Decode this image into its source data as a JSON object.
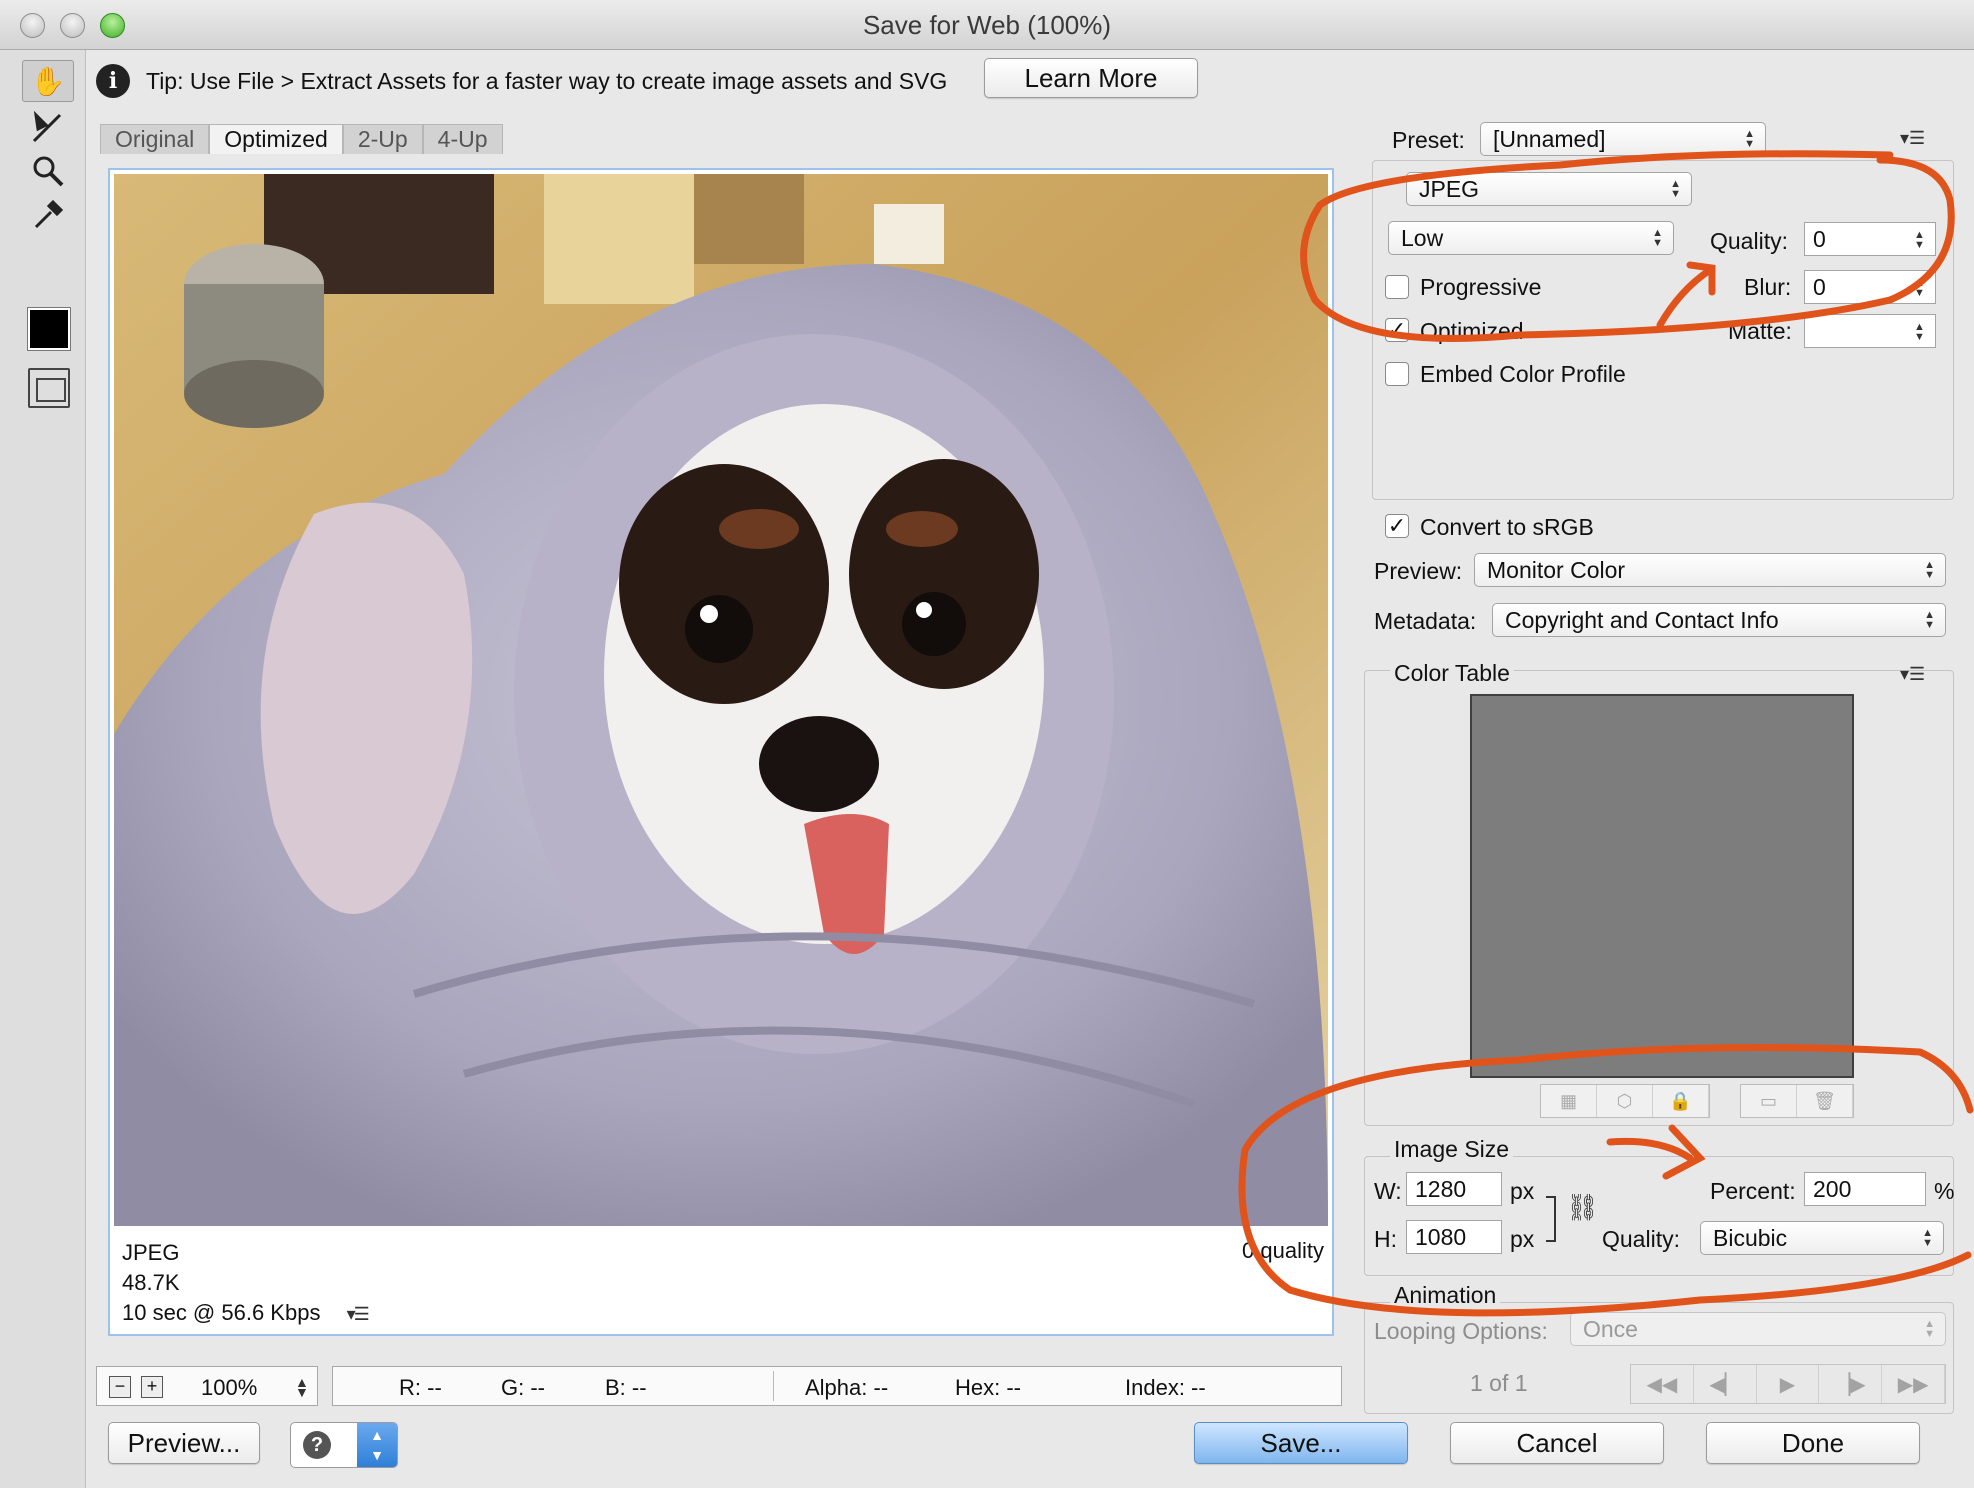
{
  "window": {
    "title": "Save for Web (100%)"
  },
  "tip": {
    "text": "Tip: Use File > Extract Assets for a faster way to create image assets and SVG",
    "learn_more": "Learn More"
  },
  "view_tabs": [
    "Original",
    "Optimized",
    "2-Up",
    "4-Up"
  ],
  "preview": {
    "format": "JPEG",
    "size": "48.7K",
    "download_time": "10 sec @ 56.6 Kbps",
    "quality_note": "0 quality"
  },
  "status": {
    "zoom": "100%",
    "r": "R: --",
    "g": "G: --",
    "b": "B: --",
    "alpha": "Alpha: --",
    "hex": "Hex: --",
    "index": "Index: --"
  },
  "settings": {
    "preset_label": "Preset:",
    "preset_value": "[Unnamed]",
    "format_value": "JPEG",
    "compression_value": "Low",
    "quality_label": "Quality:",
    "quality_value": "0",
    "blur_label": "Blur:",
    "blur_value": "0",
    "matte_label": "Matte:",
    "matte_value": "",
    "progressive_label": "Progressive",
    "progressive_checked": false,
    "optimized_label": "Optimized",
    "optimized_checked": true,
    "embed_label": "Embed Color Profile",
    "embed_checked": false,
    "convert_label": "Convert to sRGB",
    "convert_checked": true,
    "preview_label": "Preview:",
    "preview_value": "Monitor Color",
    "metadata_label": "Metadata:",
    "metadata_value": "Copyright and Contact Info"
  },
  "color_table": {
    "title": "Color Table"
  },
  "image_size": {
    "title": "Image Size",
    "w_label": "W:",
    "w_value": "1280",
    "w_unit": "px",
    "h_label": "H:",
    "h_value": "1080",
    "h_unit": "px",
    "percent_label": "Percent:",
    "percent_value": "200",
    "percent_unit": "%",
    "quality_label": "Quality:",
    "quality_value": "Bicubic"
  },
  "animation": {
    "title": "Animation",
    "looping_label": "Looping Options:",
    "looping_value": "Once",
    "frame_counter": "1 of 1"
  },
  "buttons": {
    "preview": "Preview...",
    "save": "Save...",
    "cancel": "Cancel",
    "done": "Done"
  },
  "colors": {
    "annotation": "#e0541c",
    "save_button": "#7fb6ee",
    "preview_border": "#9dc3ec"
  }
}
